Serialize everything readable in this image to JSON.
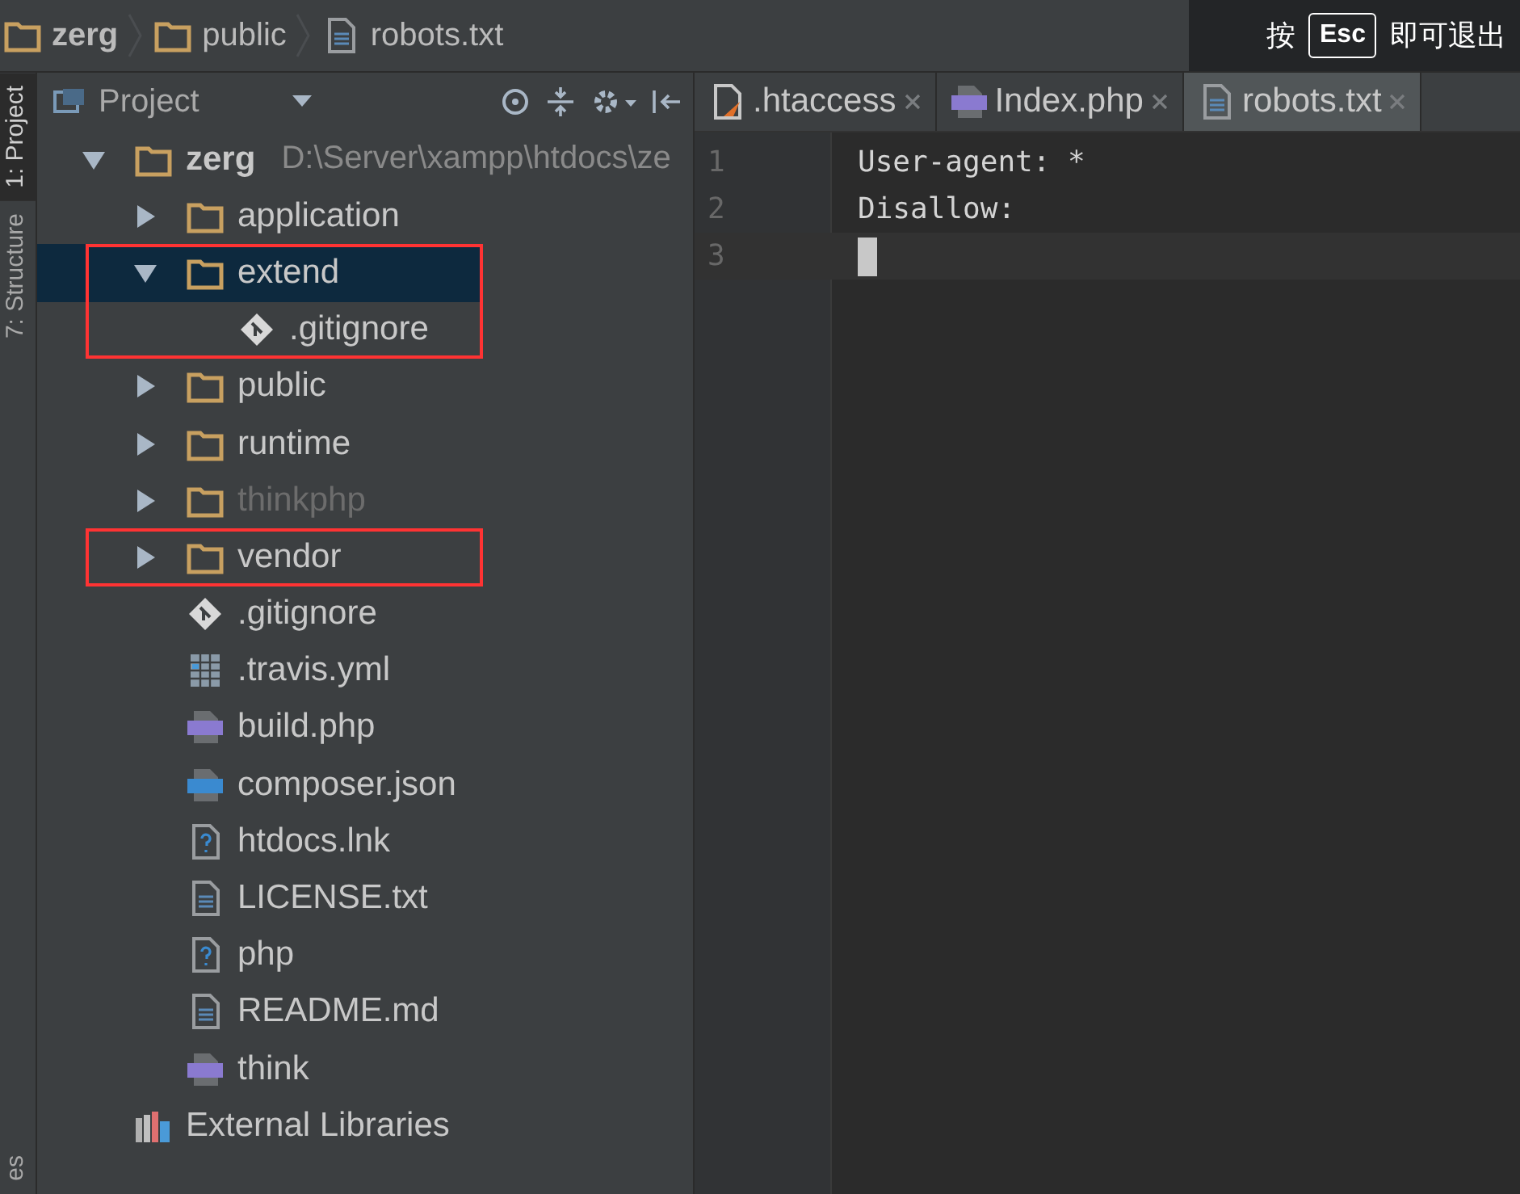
{
  "breadcrumbs": [
    {
      "label": "zerg",
      "kind": "folder"
    },
    {
      "label": "public",
      "kind": "folder"
    },
    {
      "label": "robots.txt",
      "kind": "text"
    }
  ],
  "side_tabs": [
    {
      "label": "1: Project",
      "selected": true
    },
    {
      "label": "7: Structure",
      "selected": false
    }
  ],
  "side_tabs_bottom": [
    {
      "label": "es",
      "selected": false
    }
  ],
  "project_panel": {
    "title": "Project",
    "tree": [
      {
        "label": "zerg",
        "path": "D:\\Server\\xampp\\htdocs\\ze",
        "kind": "folder",
        "expanded": true,
        "selected": false,
        "dimmed": false,
        "children": [
          {
            "label": "application",
            "kind": "folder",
            "expanded": false,
            "selected": false,
            "dimmed": false,
            "highlighted": false
          },
          {
            "label": "extend",
            "kind": "folder",
            "expanded": true,
            "selected": true,
            "dimmed": false,
            "highlighted": true,
            "children": [
              {
                "label": ".gitignore",
                "kind": "git",
                "selected": false,
                "dimmed": false
              }
            ]
          },
          {
            "label": "public",
            "kind": "folder",
            "expanded": false,
            "selected": false,
            "dimmed": false,
            "highlighted": false
          },
          {
            "label": "runtime",
            "kind": "folder",
            "expanded": false,
            "selected": false,
            "dimmed": false,
            "highlighted": false
          },
          {
            "label": "thinkphp",
            "kind": "folder",
            "expanded": false,
            "selected": false,
            "dimmed": true,
            "highlighted": false
          },
          {
            "label": "vendor",
            "kind": "folder",
            "expanded": false,
            "selected": false,
            "dimmed": false,
            "highlighted": true
          },
          {
            "label": ".gitignore",
            "kind": "git",
            "selected": false,
            "dimmed": false,
            "highlighted": false
          },
          {
            "label": ".travis.yml",
            "kind": "yaml",
            "selected": false,
            "dimmed": false,
            "highlighted": false
          },
          {
            "label": "build.php",
            "kind": "php",
            "selected": false,
            "dimmed": false,
            "highlighted": false
          },
          {
            "label": "composer.json",
            "kind": "json",
            "selected": false,
            "dimmed": false,
            "highlighted": false
          },
          {
            "label": "htdocs.lnk",
            "kind": "unknown",
            "selected": false,
            "dimmed": false,
            "highlighted": false
          },
          {
            "label": "LICENSE.txt",
            "kind": "text",
            "selected": false,
            "dimmed": false,
            "highlighted": false
          },
          {
            "label": "php",
            "kind": "unknown",
            "selected": false,
            "dimmed": false,
            "highlighted": false
          },
          {
            "label": "README.md",
            "kind": "text",
            "selected": false,
            "dimmed": false,
            "highlighted": false
          },
          {
            "label": "think",
            "kind": "php",
            "selected": false,
            "dimmed": false,
            "highlighted": false
          }
        ]
      },
      {
        "label": "External Libraries",
        "kind": "libraries",
        "selected": false,
        "dimmed": false
      }
    ]
  },
  "editor_tabs": [
    {
      "label": ".htaccess",
      "kind": "htaccess",
      "selected": false
    },
    {
      "label": "Index.php",
      "kind": "php",
      "selected": false
    },
    {
      "label": "robots.txt",
      "kind": "text",
      "selected": true
    }
  ],
  "editor": {
    "lines": [
      {
        "number": "1",
        "text": "User-agent: *",
        "current": false
      },
      {
        "number": "2",
        "text": "Disallow:",
        "current": false
      },
      {
        "number": "3",
        "current": true
      }
    ]
  },
  "toast": {
    "before": "按",
    "key": "Esc",
    "after": "即可退出"
  }
}
